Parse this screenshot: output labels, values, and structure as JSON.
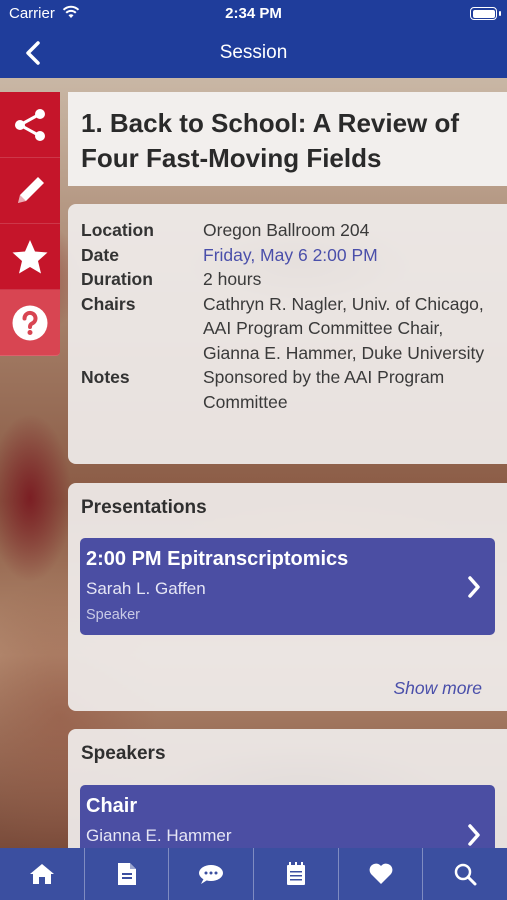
{
  "status_bar": {
    "carrier": "Carrier",
    "time": "2:34 PM"
  },
  "nav": {
    "title": "Session",
    "back_icon": "chevron-left-icon"
  },
  "side_actions": [
    {
      "name": "share",
      "icon": "share-icon"
    },
    {
      "name": "note",
      "icon": "pencil-icon"
    },
    {
      "name": "favorite",
      "icon": "star-icon"
    },
    {
      "name": "help",
      "icon": "question-icon"
    }
  ],
  "session": {
    "title": "1. Back to School: A Review of Four Fast-Moving Fields",
    "details": [
      {
        "label": "Location",
        "value": "Oregon Ballroom 204"
      },
      {
        "label": "Date",
        "value": "Friday, May 6 2:00 PM",
        "link": true
      },
      {
        "label": "Duration",
        "value": "2 hours"
      },
      {
        "label": "Chairs",
        "value": "Cathryn R. Nagler, Univ. of Chicago, AAI Program Committee Chair, Gianna E.  Hammer, Duke University"
      },
      {
        "label": "Notes",
        "value": "Sponsored by the AAI Program Committee"
      }
    ]
  },
  "presentations": {
    "heading": "Presentations",
    "items": [
      {
        "title": "2:00 PM  Epitranscriptomics",
        "speaker": "Sarah L. Gaffen",
        "role": "Speaker"
      }
    ],
    "show_more": "Show more"
  },
  "speakers": {
    "heading": "Speakers",
    "items": [
      {
        "role": "Chair",
        "name": "Gianna E. Hammer"
      }
    ]
  },
  "tab_bar": [
    {
      "name": "home",
      "icon": "home-icon"
    },
    {
      "name": "documents",
      "icon": "document-icon"
    },
    {
      "name": "messages",
      "icon": "chat-icon"
    },
    {
      "name": "notes",
      "icon": "notepad-icon"
    },
    {
      "name": "favorites",
      "icon": "heart-icon"
    },
    {
      "name": "search",
      "icon": "search-icon"
    }
  ],
  "colors": {
    "nav": "#1f3d9b",
    "side_red": "#c5152a",
    "item_purple": "#4b4ea3",
    "tabbar": "#3b4fa0"
  }
}
